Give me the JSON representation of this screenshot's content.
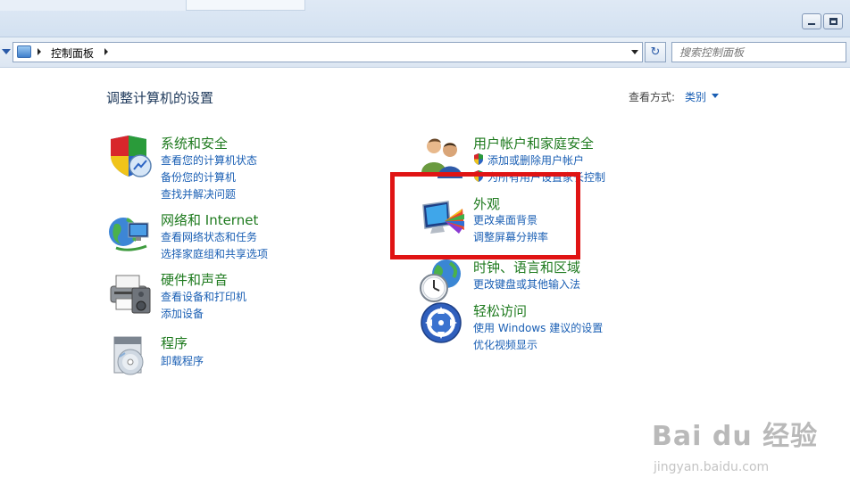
{
  "address": {
    "breadcrumb": "控制面板",
    "search_placeholder": "搜索控制面板"
  },
  "page": {
    "title": "调整计算机的设置",
    "view_by_label": "查看方式:",
    "view_by_value": "类别"
  },
  "categories": [
    {
      "title": "系统和安全",
      "icon": "security-shield-icon",
      "links": [
        "查看您的计算机状态",
        "备份您的计算机",
        "查找并解决问题"
      ]
    },
    {
      "title": "网络和 Internet",
      "icon": "network-globe-icon",
      "links": [
        "查看网络状态和任务",
        "选择家庭组和共享选项"
      ]
    },
    {
      "title": "硬件和声音",
      "icon": "printer-icon",
      "links": [
        "查看设备和打印机",
        "添加设备"
      ]
    },
    {
      "title": "程序",
      "icon": "programs-disc-icon",
      "links": [
        "卸载程序"
      ]
    },
    {
      "title": "用户帐户和家庭安全",
      "icon": "users-icon",
      "links": [
        "添加或删除用户帐户",
        "为所有用户设置家长控制"
      ]
    },
    {
      "title": "外观",
      "icon": "appearance-monitor-icon",
      "links": [
        "更改桌面背景",
        "调整屏幕分辨率"
      ]
    },
    {
      "title": "时钟、语言和区域",
      "icon": "clock-globe-icon",
      "links": [
        "更改键盘或其他输入法"
      ]
    },
    {
      "title": "轻松访问",
      "icon": "ease-of-access-icon",
      "links": [
        "使用 Windows 建议的设置",
        "优化视频显示"
      ]
    }
  ],
  "watermark": {
    "main": "Bai du 经验",
    "sub": "jingyan.baidu.com"
  },
  "colors": {
    "category_title": "#1e7a1e",
    "link": "#1a5fb4",
    "highlight": "#e01414"
  }
}
